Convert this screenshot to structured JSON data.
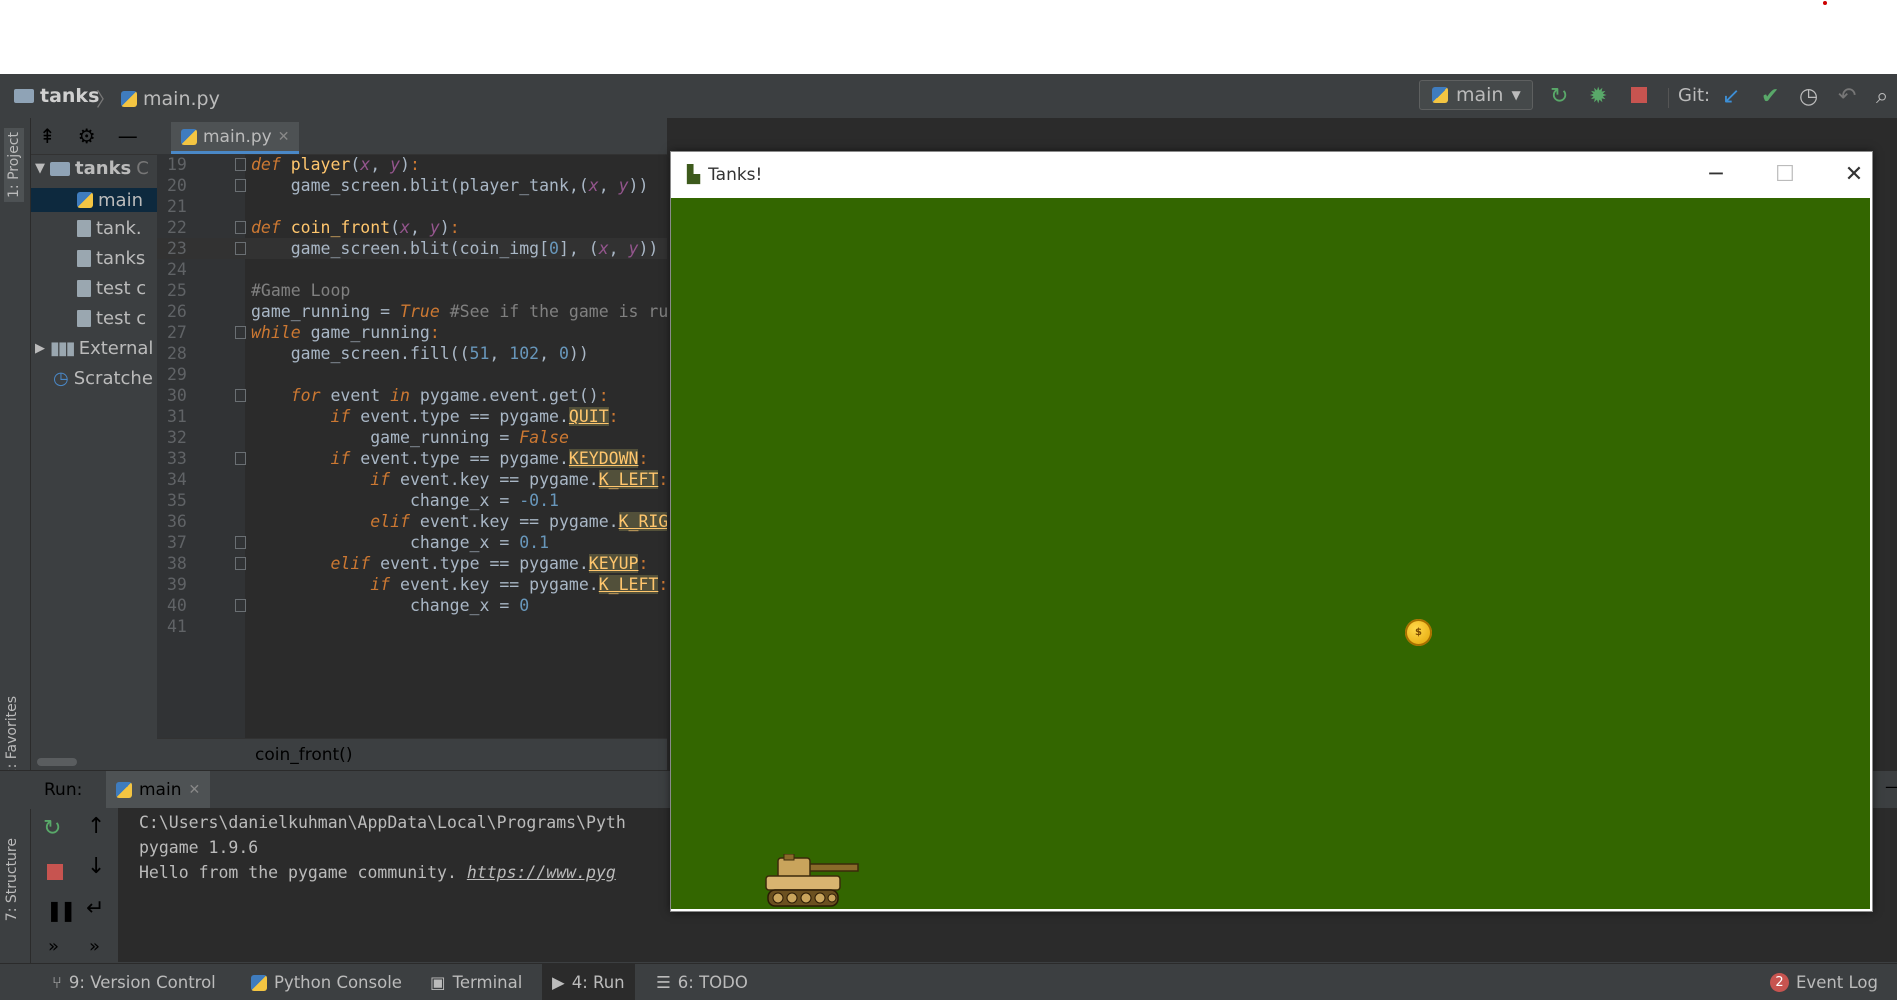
{
  "nav": {
    "project": "tanks",
    "file": "main.py"
  },
  "toolbar": {
    "run_config": "main",
    "git_label": "Git:"
  },
  "left_tabs": {
    "project": "1: Project",
    "favorites": "2: Favorites",
    "structure": "7: Structure"
  },
  "project_tree": [
    {
      "label": "tanks",
      "suffix": "C",
      "kind": "folder"
    },
    {
      "label": "main",
      "kind": "py",
      "selected": true
    },
    {
      "label": "tank.",
      "kind": "file"
    },
    {
      "label": "tanks",
      "kind": "file"
    },
    {
      "label": "test c",
      "kind": "file"
    },
    {
      "label": "test c",
      "kind": "file"
    },
    {
      "label": "External",
      "kind": "lib"
    },
    {
      "label": "Scratche",
      "kind": "scratch"
    }
  ],
  "editor_tab": "main.py",
  "code_lines": [
    {
      "n": "19",
      "html": "<span class=\"kw\">def</span> <span class=\"fn\">player</span>(<span class=\"par\">x</span>, <span class=\"par\">y</span>)<span class=\"kwn\">:</span>"
    },
    {
      "n": "20",
      "html": "    game_screen.blit(player_tank,(<span class=\"par\">x</span>, <span class=\"par\">y</span>))"
    },
    {
      "n": "21",
      "html": ""
    },
    {
      "n": "22",
      "html": "<span class=\"kw\">def</span> <span class=\"fn\">coin_front</span>(<span class=\"par\">x</span>, <span class=\"par\">y</span>)<span class=\"kwn\">:</span>"
    },
    {
      "n": "23",
      "html": "    game_screen.blit(coin_img[<span class=\"num\">0</span>], (<span class=\"par\">x</span>, <span class=\"par\">y</span>))"
    },
    {
      "n": "24",
      "html": ""
    },
    {
      "n": "25",
      "html": "<span class=\"cm\">#Game Loop</span>"
    },
    {
      "n": "26",
      "html": "game_running = <span class=\"kw\">True</span> <span class=\"cm\">#See if the game is running</span>"
    },
    {
      "n": "27",
      "html": "<span class=\"kw\">while</span> game_running<span class=\"kwn\">:</span>"
    },
    {
      "n": "28",
      "html": "    game_screen.fill((<span class=\"num\">51</span>, <span class=\"num\">102</span>, <span class=\"num\">0</span>))"
    },
    {
      "n": "29",
      "html": ""
    },
    {
      "n": "30",
      "html": "    <span class=\"kw\">for</span> event <span class=\"kw\">in</span> pygame.event.get()<span class=\"kwn\">:</span>"
    },
    {
      "n": "31",
      "html": "        <span class=\"kw\">if</span> event.type == pygame.<span class=\"hl\">QUIT</span><span class=\"kwn\">:</span>"
    },
    {
      "n": "32",
      "html": "            game_running = <span class=\"kw\">False</span>"
    },
    {
      "n": "33",
      "html": "        <span class=\"kw\">if</span> event.type == pygame.<span class=\"hl\">KEYDOWN</span><span class=\"kwn\">:</span>"
    },
    {
      "n": "34",
      "html": "            <span class=\"kw\">if</span> event.key == pygame.<span class=\"hl\">K_LEFT</span><span class=\"kwn\">:</span>"
    },
    {
      "n": "35",
      "html": "                change_x = <span class=\"num\">-0.1</span>"
    },
    {
      "n": "36",
      "html": "            <span class=\"kw\">elif</span> event.key == pygame.<span class=\"hl\">K_RIGHT</span><span class=\"kwn\">:</span>"
    },
    {
      "n": "37",
      "html": "                change_x = <span class=\"num\">0.1</span>"
    },
    {
      "n": "38",
      "html": "        <span class=\"kw\">elif</span> event.type == pygame.<span class=\"hl\">KEYUP</span><span class=\"kwn\">:</span>"
    },
    {
      "n": "39",
      "html": "            <span class=\"kw\">if</span> event.key == pygame.<span class=\"hl\">K_LEFT</span><span class=\"kwn\">:</span>"
    },
    {
      "n": "40",
      "html": "                change_x = <span class=\"num\">0</span>"
    },
    {
      "n": "41",
      "html": ""
    }
  ],
  "editor_breadcrumb": "coin_front()",
  "run_panel": {
    "label": "Run:",
    "tab": "main"
  },
  "console_lines": [
    "C:\\Users\\danielkuhman\\AppData\\Local\\Programs\\Pyth",
    "pygame 1.9.6",
    "Hello from the pygame community. "
  ],
  "console_link": "https://www.pyg",
  "status_items": [
    {
      "id": "vcs",
      "label": "9: Version Control"
    },
    {
      "id": "pyconsole",
      "label": "Python Console"
    },
    {
      "id": "terminal",
      "label": "Terminal"
    },
    {
      "id": "run",
      "label": "4: Run"
    },
    {
      "id": "todo",
      "label": "6: TODO"
    }
  ],
  "event_log": {
    "label": "Event Log",
    "count": "2"
  },
  "game_window": {
    "title": "Tanks!",
    "bg_color": "#336600"
  },
  "coin_glyph": "$"
}
